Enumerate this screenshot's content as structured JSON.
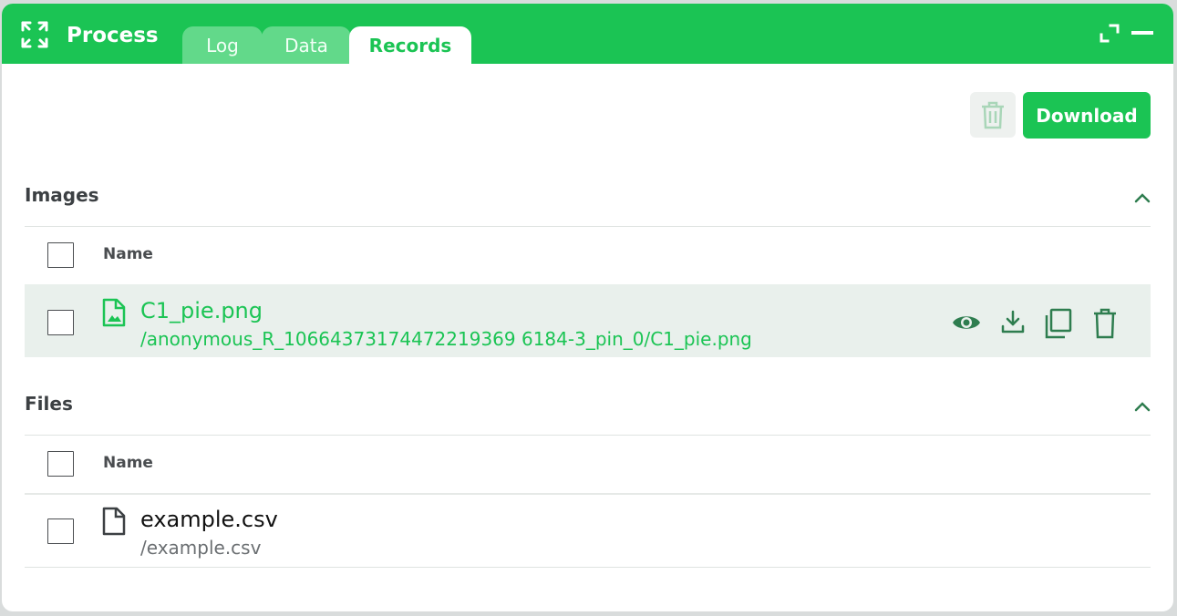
{
  "app": {
    "title": "Process",
    "icon": "fullscreen-arrows-icon"
  },
  "tabs": [
    {
      "label": "Log",
      "active": false
    },
    {
      "label": "Data",
      "active": false
    },
    {
      "label": "Records",
      "active": true
    }
  ],
  "window_controls": {
    "expand_icon": "expand-icon",
    "minimize_icon": "minimize-icon"
  },
  "toolbar": {
    "download_label": "Download",
    "delete_icon": "trash-icon"
  },
  "images": {
    "title": "Images",
    "column_header": "Name",
    "rows": [
      {
        "name": "C1_pie.png",
        "path": "/anonymous_R_10664373174472219369 6184-3_pin_0/C1_pie.png",
        "icon": "image-file-icon",
        "actions": [
          "view-icon",
          "download-icon",
          "copy-icon",
          "delete-icon"
        ]
      }
    ]
  },
  "files": {
    "title": "Files",
    "column_header": "Name",
    "rows": [
      {
        "name": "example.csv",
        "path": "/example.csv",
        "icon": "file-icon"
      }
    ]
  },
  "colors": {
    "accent": "#1bc454",
    "tab_inactive": "#62d98a",
    "row_highlight": "#e9f0ec",
    "action_icon": "#2e7d4f",
    "text_dark": "#3c4043"
  }
}
